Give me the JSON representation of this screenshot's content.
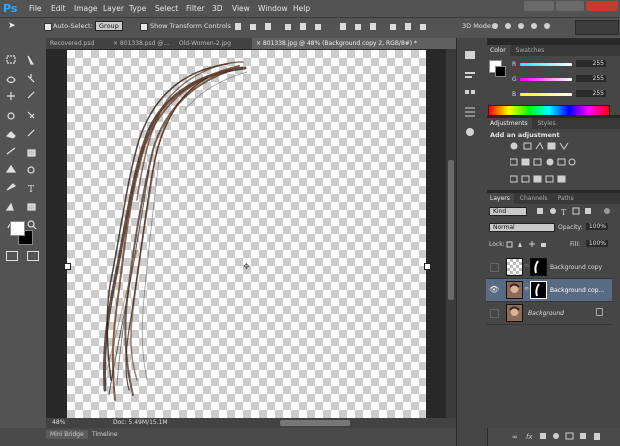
{
  "app": {
    "logo": "Ps"
  },
  "menu": [
    "File",
    "Edit",
    "Image",
    "Layer",
    "Type",
    "Select",
    "Filter",
    "3D",
    "View",
    "Window",
    "Help"
  ],
  "options": {
    "auto_select_label": "Auto-Select:",
    "auto_select_value": "Group",
    "transform_label": "Show Transform Controls",
    "mode_3d_label": "3D Mode:"
  },
  "tabs": [
    {
      "label": "Recovered.psd"
    },
    {
      "label": "× 801338.psd @..."
    },
    {
      "label": "Old-Women-2.jpg"
    },
    {
      "label": "× 801338.jpg @ 48% (Background copy 2, RGB/8#) *"
    }
  ],
  "status": {
    "zoom": "48%",
    "doc": "Doc: 5.49M/15.1M"
  },
  "bottom_tabs": [
    "Mini Bridge",
    "Timeline"
  ],
  "color_panel": {
    "tabs": [
      "Color",
      "Swatches"
    ],
    "channels": [
      {
        "label": "R",
        "value": "255"
      },
      {
        "label": "G",
        "value": "255"
      },
      {
        "label": "B",
        "value": "255"
      }
    ]
  },
  "adjustments": {
    "tabs": [
      "Adjustments",
      "Styles"
    ],
    "title": "Add an adjustment"
  },
  "layers_panel": {
    "tabs": [
      "Layers",
      "Channels",
      "Paths"
    ],
    "kind": "Kind",
    "blend_mode": "Normal",
    "opacity_label": "Opacity:",
    "opacity_value": "100%",
    "lock_label": "Lock:",
    "fill_label": "Fill:",
    "fill_value": "100%",
    "layers": [
      {
        "name": "Background copy"
      },
      {
        "name": "Background cop..."
      },
      {
        "name": "Background"
      }
    ]
  },
  "colors": {
    "accent": "#31a8ff",
    "selected_layer": "#596a85"
  }
}
